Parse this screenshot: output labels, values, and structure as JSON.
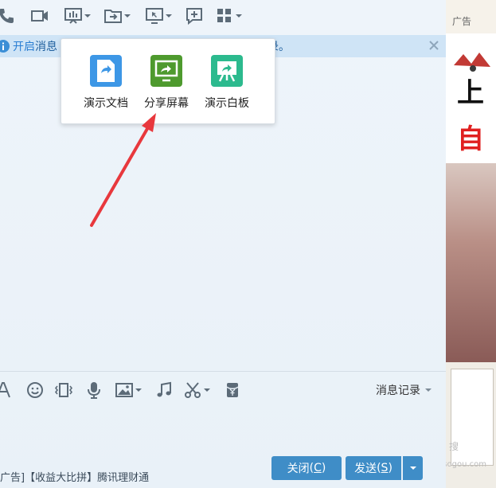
{
  "notice": {
    "prefix": "开启",
    "text": "消息",
    "tail": "录。"
  },
  "share_menu": {
    "items": [
      {
        "label": "演示文档",
        "icon": "document-share-icon",
        "color": "#3d97e6"
      },
      {
        "label": "分享屏幕",
        "icon": "screen-share-icon",
        "color": "#4e9a2e"
      },
      {
        "label": "演示白板",
        "icon": "whiteboard-icon",
        "color": "#2cba8e"
      }
    ]
  },
  "history_label": "消息记录",
  "ad_text": "广告]【收益大比拼】腾讯理财通",
  "buttons": {
    "close": "关闭",
    "close_key": "C",
    "send": "发送",
    "send_key": "S"
  },
  "right_panel": {
    "ad_label": "广告",
    "headline_1": "上",
    "headline_2": "自",
    "watermark": "搜",
    "watermark_url": "zhinan.sogou.com"
  },
  "colors": {
    "accent": "#3f8dc7",
    "notice_bg": "#cfe4f6",
    "arrow": "#e8383d"
  }
}
